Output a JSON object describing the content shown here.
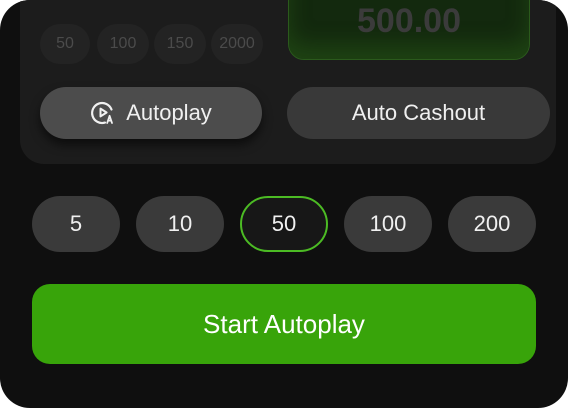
{
  "quick_amounts": [
    "50",
    "100",
    "150",
    "2000"
  ],
  "amount_display": "500.00",
  "modes": {
    "autoplay_label": "Autoplay",
    "auto_cashout_label": "Auto Cashout"
  },
  "bet_chips": [
    "5",
    "10",
    "50",
    "100",
    "200"
  ],
  "selected_bet": "50",
  "start_button_label": "Start Autoplay",
  "colors": {
    "accent_green": "#38a40a",
    "selected_border": "#4cbb24",
    "background": "#0f0f0f"
  },
  "icons": {
    "autoplay": "play-circle-auto-icon"
  }
}
